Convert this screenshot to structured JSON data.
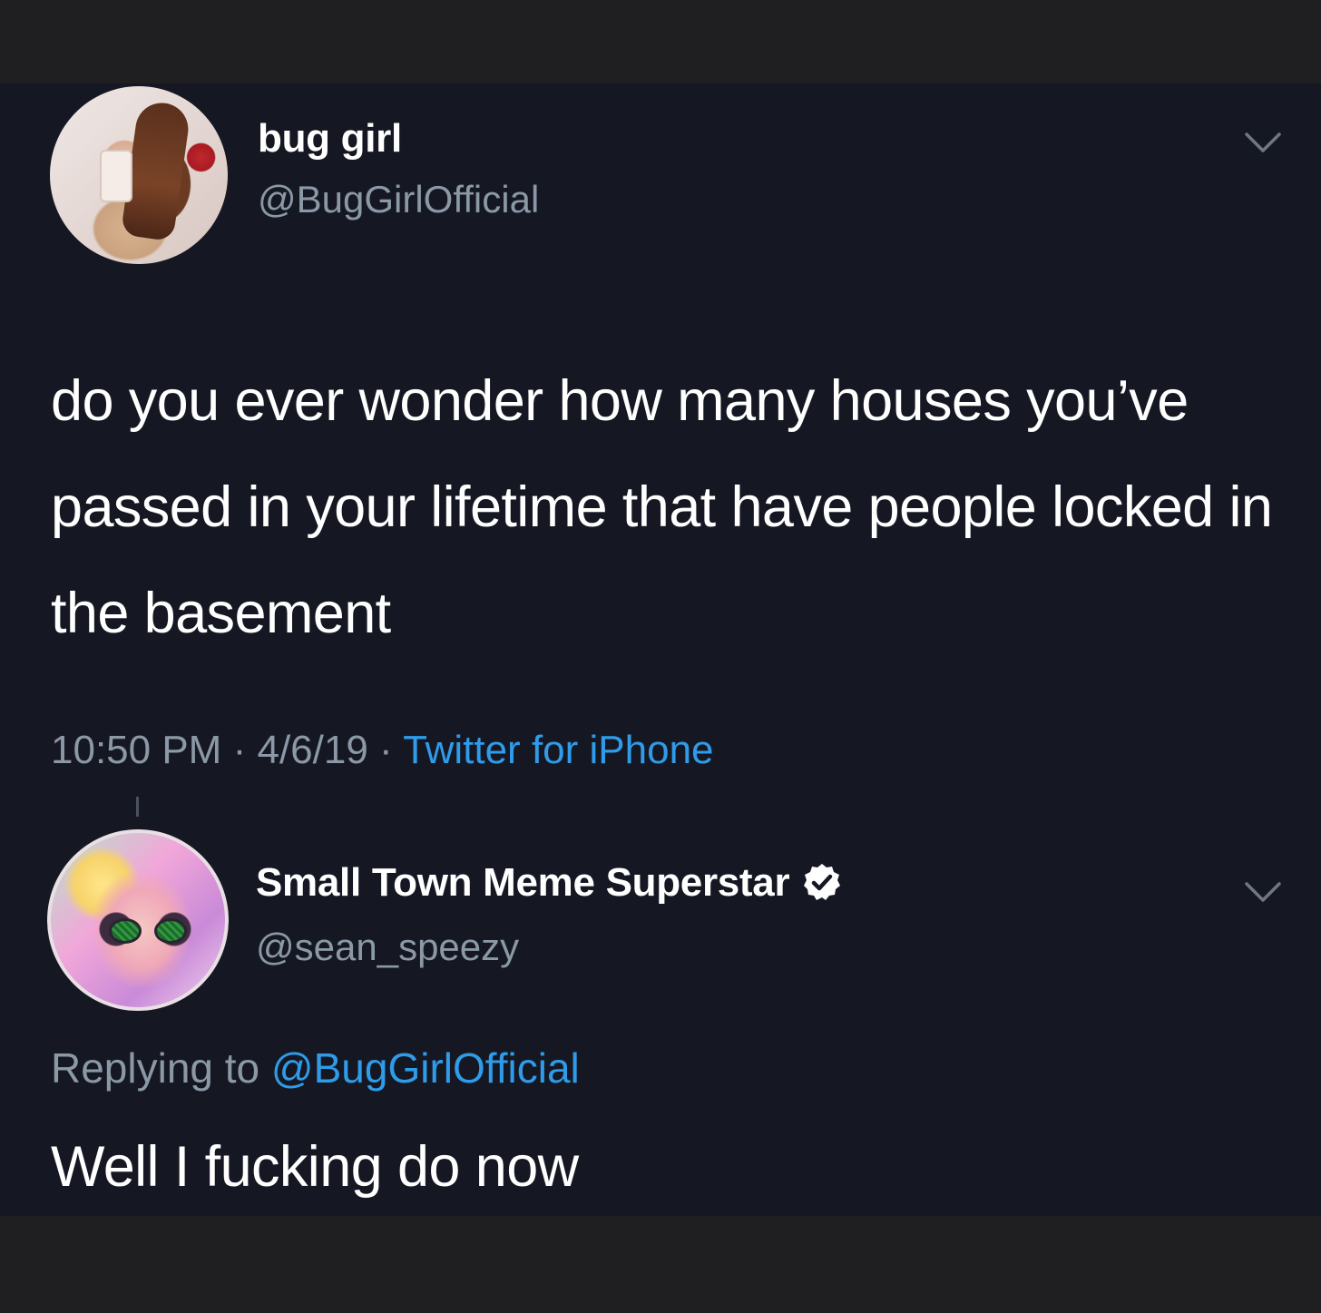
{
  "tweet": {
    "display_name": "bug girl",
    "handle": "@BugGirlOfficial",
    "text": "do you ever wonder how many houses you’ve passed in your lifetime that have people locked in the basement",
    "time": "10:50 PM",
    "separator": "·",
    "date": "4/6/19",
    "source": "Twitter for iPhone",
    "avatar_icon": "profile-photo-avatar"
  },
  "reply": {
    "display_name": "Small Town Meme Superstar",
    "verified": true,
    "handle": "@sean_speezy",
    "replying_prefix": "Replying to",
    "replying_to": "@BugGirlOfficial",
    "text": "Well I fucking do now",
    "avatar_icon": "profile-photo-avatar"
  },
  "colors": {
    "background": "#151822",
    "frame": "#1f1f21",
    "primary_text": "#ffffff",
    "secondary_text": "#8b98a6",
    "link": "#2f9be9"
  },
  "icons": [
    "chevron-down-icon",
    "verified-badge-icon"
  ]
}
